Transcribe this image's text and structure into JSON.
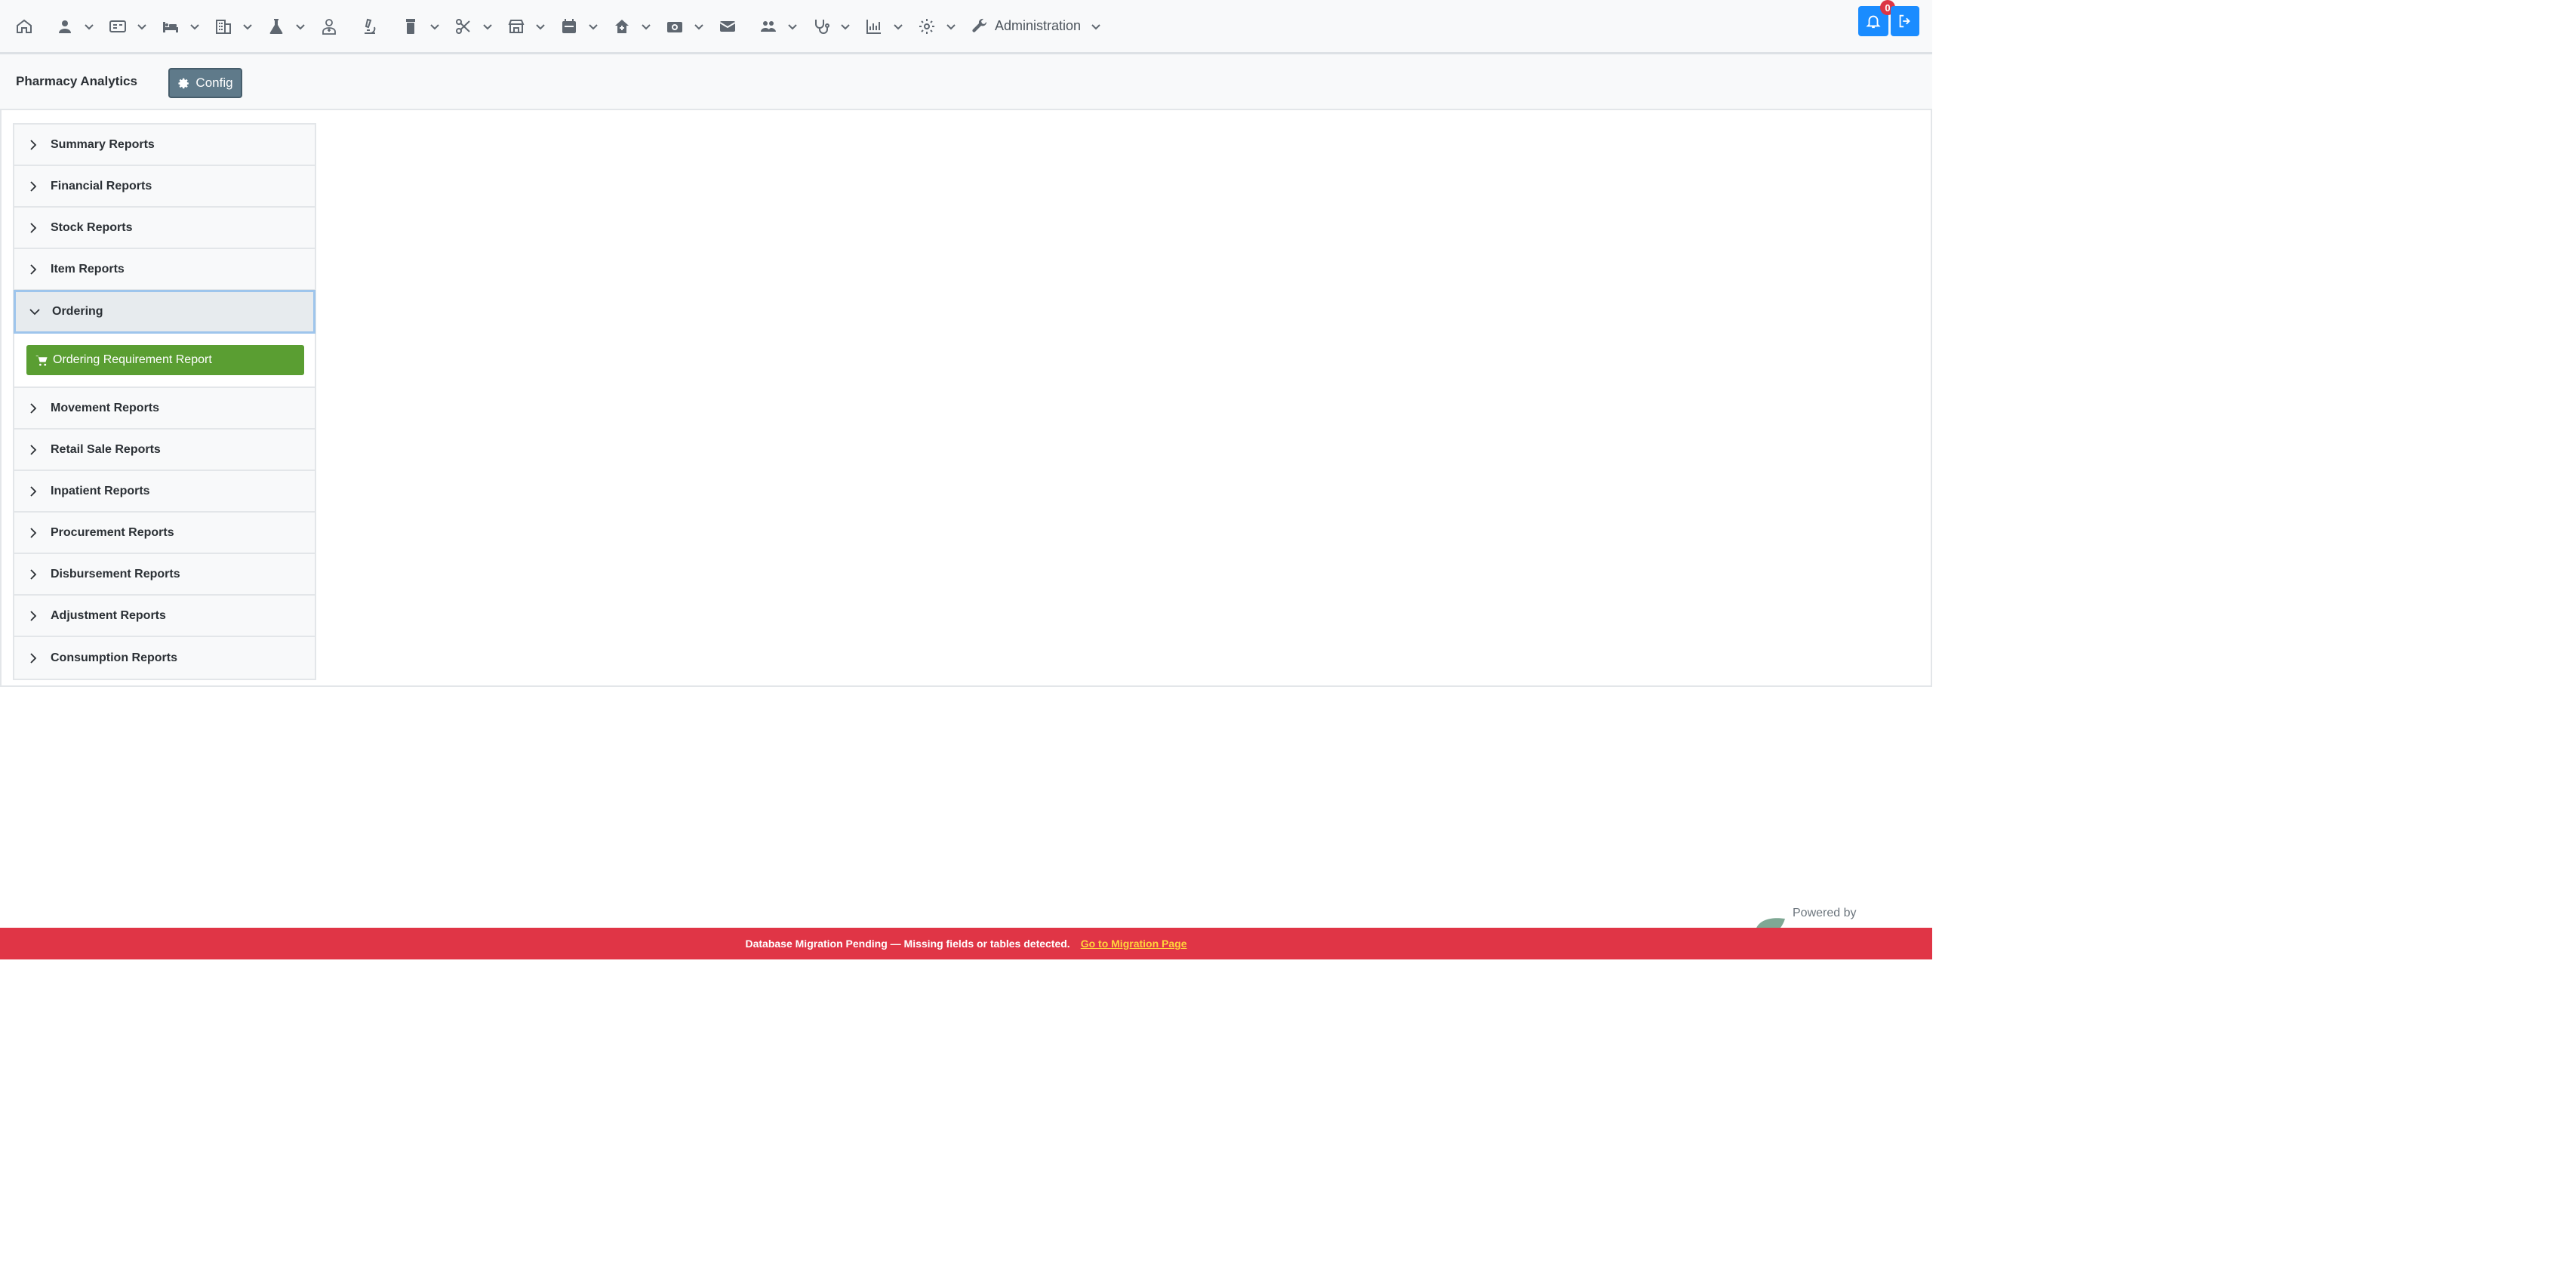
{
  "nav": {
    "administration_label": "Administration",
    "notification_count": "0",
    "icons": [
      "home-icon",
      "user-icon",
      "id-card-icon",
      "bed-icon",
      "building-icon",
      "flask-icon",
      "doctor-icon",
      "microscope-icon",
      "pill-bottle-icon",
      "scissors-icon",
      "store-icon",
      "calendar-icon",
      "house-medical-icon",
      "camera-icon",
      "envelope-icon",
      "users-icon",
      "stethoscope-icon",
      "chart-icon",
      "gear-icon",
      "wrench-icon",
      "bell-icon",
      "logout-icon"
    ]
  },
  "header": {
    "title": "Pharmacy Analytics",
    "config_label": "Config"
  },
  "accordion": {
    "items": [
      {
        "label": "Summary Reports"
      },
      {
        "label": "Financial Reports"
      },
      {
        "label": "Stock Reports"
      },
      {
        "label": "Item Reports"
      },
      {
        "label": "Ordering",
        "expanded": true
      },
      {
        "label": "Movement Reports"
      },
      {
        "label": "Retail Sale Reports"
      },
      {
        "label": "Inpatient Reports"
      },
      {
        "label": "Procurement Reports"
      },
      {
        "label": "Disbursement Reports"
      },
      {
        "label": "Adjustment Reports"
      },
      {
        "label": "Consumption Reports"
      }
    ],
    "ordering_button_label": "Ordering Requirement Report"
  },
  "footer": {
    "powered_by": "Powered by",
    "warning_text": "Database Migration Pending — Missing fields or tables detected.",
    "migration_link": "Go to Migration Page"
  },
  "colors": {
    "primary": "#1a8cff",
    "success": "#5a9e32",
    "danger": "#e03546",
    "config": "#5f7a8a"
  }
}
